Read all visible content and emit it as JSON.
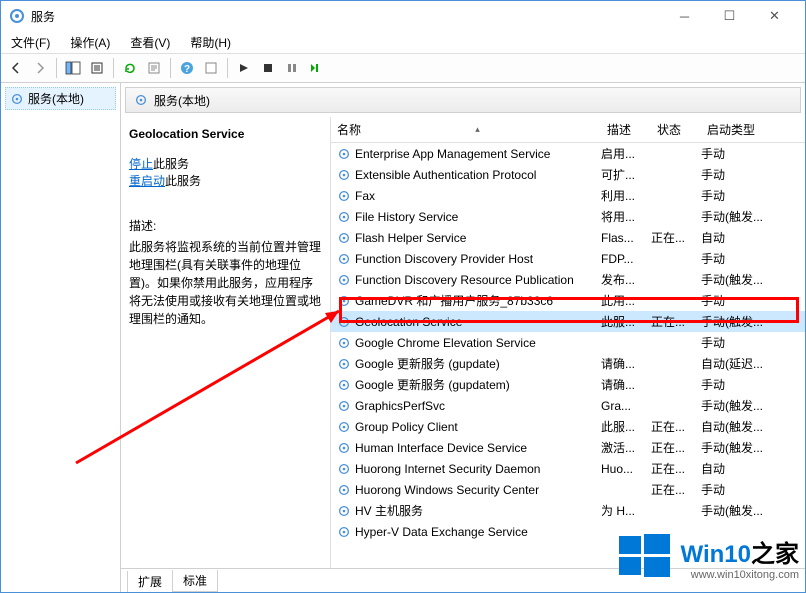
{
  "window": {
    "title": "服务"
  },
  "menu": {
    "file": "文件(F)",
    "action": "操作(A)",
    "view": "查看(V)",
    "help": "帮助(H)"
  },
  "tree": {
    "root": "服务(本地)"
  },
  "rightHeader": "服务(本地)",
  "detail": {
    "selectedName": "Geolocation Service",
    "stop": "停止",
    "stopSuffix": "此服务",
    "restart": "重启动",
    "restartSuffix": "此服务",
    "descLabel": "描述:",
    "descText": "此服务将监视系统的当前位置并管理地理围栏(具有关联事件的地理位置)。如果你禁用此服务，应用程序将无法使用或接收有关地理位置或地理围栏的通知。"
  },
  "columns": {
    "name": "名称",
    "desc": "描述",
    "status": "状态",
    "startup": "启动类型"
  },
  "services": [
    {
      "name": "Enterprise App Management Service",
      "desc": "启用...",
      "status": "",
      "startup": "手动"
    },
    {
      "name": "Extensible Authentication Protocol",
      "desc": "可扩...",
      "status": "",
      "startup": "手动"
    },
    {
      "name": "Fax",
      "desc": "利用...",
      "status": "",
      "startup": "手动"
    },
    {
      "name": "File History Service",
      "desc": "将用...",
      "status": "",
      "startup": "手动(触发..."
    },
    {
      "name": "Flash Helper Service",
      "desc": "Flas...",
      "status": "正在...",
      "startup": "自动"
    },
    {
      "name": "Function Discovery Provider Host",
      "desc": "FDP...",
      "status": "",
      "startup": "手动"
    },
    {
      "name": "Function Discovery Resource Publication",
      "desc": "发布...",
      "status": "",
      "startup": "手动(触发..."
    },
    {
      "name": "GameDVR 和广播用户服务_87b33c6",
      "desc": "此用...",
      "status": "",
      "startup": "手动"
    },
    {
      "name": "Geolocation Service",
      "desc": "此服...",
      "status": "正在...",
      "startup": "手动(触发...",
      "selected": true
    },
    {
      "name": "Google Chrome Elevation Service",
      "desc": "",
      "status": "",
      "startup": "手动"
    },
    {
      "name": "Google 更新服务 (gupdate)",
      "desc": "请确...",
      "status": "",
      "startup": "自动(延迟..."
    },
    {
      "name": "Google 更新服务 (gupdatem)",
      "desc": "请确...",
      "status": "",
      "startup": "手动"
    },
    {
      "name": "GraphicsPerfSvc",
      "desc": "Gra...",
      "status": "",
      "startup": "手动(触发..."
    },
    {
      "name": "Group Policy Client",
      "desc": "此服...",
      "status": "正在...",
      "startup": "自动(触发..."
    },
    {
      "name": "Human Interface Device Service",
      "desc": "激活...",
      "status": "正在...",
      "startup": "手动(触发..."
    },
    {
      "name": "Huorong Internet Security Daemon",
      "desc": "Huo...",
      "status": "正在...",
      "startup": "自动"
    },
    {
      "name": "Huorong Windows Security Center",
      "desc": "",
      "status": "正在...",
      "startup": "手动"
    },
    {
      "name": "HV 主机服务",
      "desc": "为 H...",
      "status": "",
      "startup": "手动(触发..."
    },
    {
      "name": "Hyper-V Data Exchange Service",
      "desc": "",
      "status": "",
      "startup": ""
    }
  ],
  "tabs": {
    "extended": "扩展",
    "standard": "标准"
  },
  "watermark": {
    "line1a": "Win10",
    "line1b": "之家",
    "line2": "www.win10xitong.com"
  }
}
